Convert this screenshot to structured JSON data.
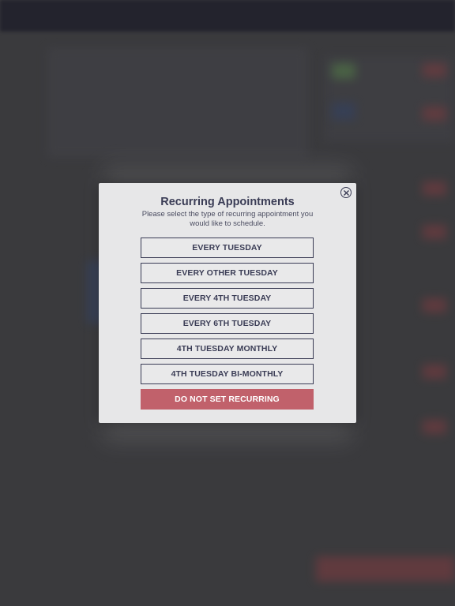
{
  "modal": {
    "title": "Recurring Appointments",
    "description": "Please select the type of recurring appointment you would like to schedule.",
    "close_icon": "close-circle-icon",
    "options": [
      {
        "label": "EVERY TUESDAY"
      },
      {
        "label": "EVERY OTHER TUESDAY"
      },
      {
        "label": "EVERY 4TH TUESDAY"
      },
      {
        "label": "EVERY 6TH TUESDAY"
      },
      {
        "label": "4TH TUESDAY MONTHLY"
      },
      {
        "label": "4TH TUESDAY BI-MONTHLY"
      }
    ],
    "cancel_label": "DO NOT SET RECURRING"
  },
  "colors": {
    "backdrop": "#3a3a3d",
    "modal_bg": "#e7e7e8",
    "navy": "#3a3c55",
    "danger": "#c1616b"
  }
}
